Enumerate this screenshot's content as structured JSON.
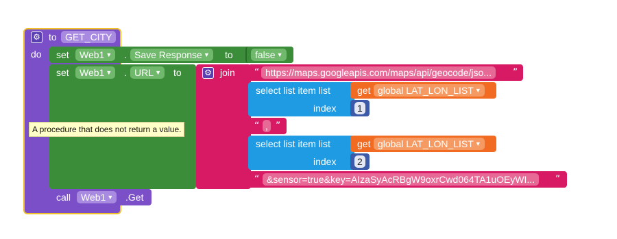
{
  "colors": {
    "procedure": "#7b4fc8",
    "procedure_border": "#f0c02a",
    "setter": "#3c8d3a",
    "text": "#d81a64",
    "list": "#1e9be3",
    "variable": "#f26b22",
    "math": "#3c5aa8",
    "logic_false": "#3c8d3a"
  },
  "procedure": {
    "to_label": "to",
    "name": "GET_CITY",
    "do_label": "do"
  },
  "set_save_response": {
    "set_label": "set",
    "component": "Web1",
    "dot": ".",
    "property": "Save Response",
    "to_label": "to",
    "value": "false"
  },
  "set_url": {
    "set_label": "set",
    "component": "Web1",
    "dot": ".",
    "property": "URL",
    "to_label": "to",
    "join_label": "join"
  },
  "join_items": {
    "url_text": "https://maps.googleapis.com/maps/api/geocode/jso...",
    "comma_text": ",",
    "sensor_text": "&sensor=true&key=AIzaSyAcRBgW9oxrCwd064TA1uOEyWI...",
    "open_quote": "“",
    "close_quote": "”"
  },
  "select_1": {
    "label": "select list item  list",
    "get_label": "get",
    "variable": "global LAT_LON_LIST",
    "index_label": "index",
    "index_value": "1"
  },
  "select_2": {
    "label": "select list item  list",
    "get_label": "get",
    "variable": "global LAT_LON_LIST",
    "index_label": "index",
    "index_value": "2"
  },
  "call": {
    "call_label": "call",
    "component": "Web1",
    "method": ".Get"
  },
  "tooltip": {
    "text": "A procedure that does not return a value."
  },
  "icons": {
    "mutator": "gear-icon",
    "dropdown": "chevron-down-icon"
  }
}
